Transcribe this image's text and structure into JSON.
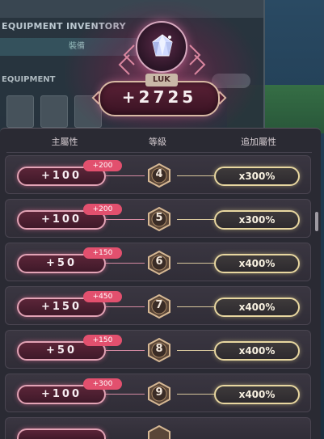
{
  "background": {
    "window_title": "EQUIPMENT INVENTORY",
    "subtab": "裝備",
    "section": "EQUIPMENT"
  },
  "stat": {
    "name": "LUK",
    "value": "+2725"
  },
  "table": {
    "headers": [
      "主屬性",
      "等級",
      "追加屬性"
    ],
    "rows": [
      {
        "main": "+100",
        "bonus": "+200",
        "level": "4",
        "multiplier": "x300%"
      },
      {
        "main": "+100",
        "bonus": "+200",
        "level": "5",
        "multiplier": "x300%"
      },
      {
        "main": "+50",
        "bonus": "+150",
        "level": "6",
        "multiplier": "x400%"
      },
      {
        "main": "+150",
        "bonus": "+450",
        "level": "7",
        "multiplier": "x400%"
      },
      {
        "main": "+50",
        "bonus": "+150",
        "level": "8",
        "multiplier": "x400%"
      },
      {
        "main": "+100",
        "bonus": "+300",
        "level": "9",
        "multiplier": "x400%"
      },
      {
        "main": "",
        "bonus": "",
        "level": "",
        "multiplier": ""
      }
    ]
  },
  "colors": {
    "main_accent": "#e2a3b5",
    "bonus_badge": "#e2506e",
    "multiplier_accent": "#e8d7a0",
    "panel_bg": "#2a2a33"
  },
  "icons": {
    "emblem": "crystal-gem-icon",
    "level_frame": "bronze-hexagon-icon"
  }
}
